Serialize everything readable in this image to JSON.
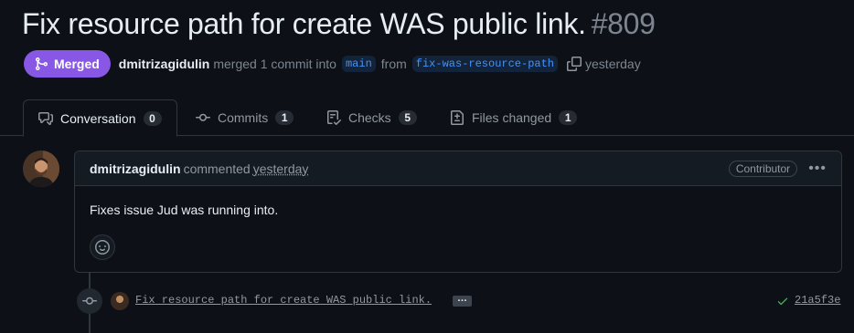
{
  "pr": {
    "title": "Fix resource path for create WAS public link.",
    "number": "#809"
  },
  "status": {
    "badge": "Merged",
    "author": "dmitrizagidulin",
    "merged_text": "merged 1 commit into",
    "base_branch": "main",
    "from_text": "from",
    "head_branch": "fix-was-resource-path",
    "time": "yesterday"
  },
  "tabs": [
    {
      "label": "Conversation",
      "count": "0",
      "icon": "comment-discussion-icon"
    },
    {
      "label": "Commits",
      "count": "1",
      "icon": "git-commit-icon"
    },
    {
      "label": "Checks",
      "count": "5",
      "icon": "checklist-icon"
    },
    {
      "label": "Files changed",
      "count": "1",
      "icon": "file-diff-icon"
    }
  ],
  "comment": {
    "author": "dmitrizagidulin",
    "action": "commented",
    "time": "yesterday",
    "role": "Contributor",
    "body": "Fixes issue Jud was running into."
  },
  "commit": {
    "message": "Fix resource path for create WAS public link.",
    "expand": "…",
    "sha": "21a5f3e"
  },
  "colors": {
    "background": "#0d1117",
    "merged": "#8957e5",
    "link": "#4493f8",
    "success": "#3fb950"
  }
}
